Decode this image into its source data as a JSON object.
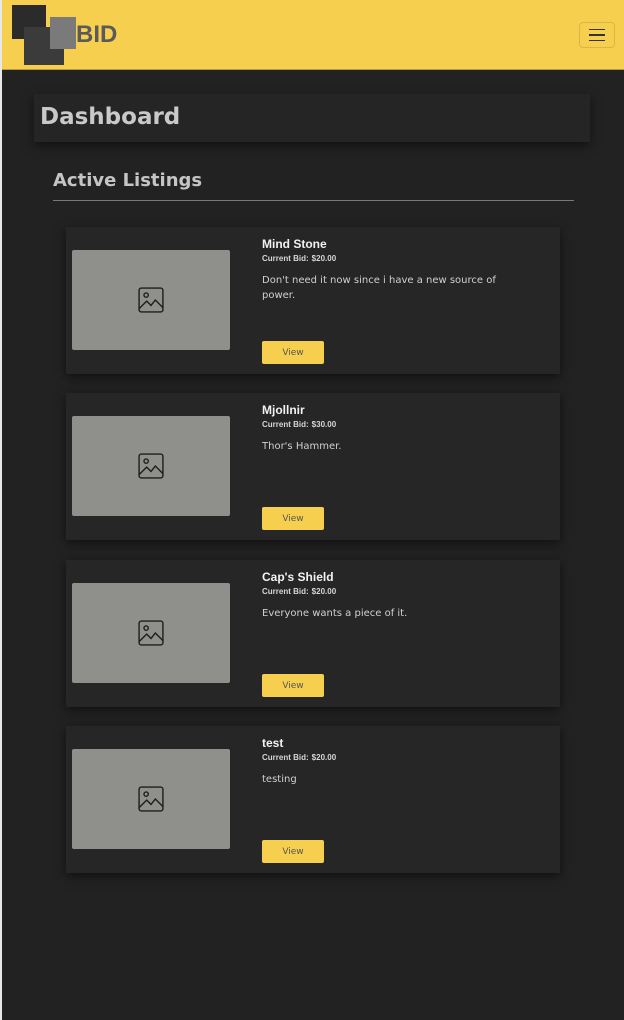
{
  "navbar": {
    "logo_text": "BID",
    "toggle_icon": "hamburger-menu-icon",
    "background": "#f7cf4f"
  },
  "page": {
    "title": "Dashboard"
  },
  "section": {
    "title": "Active Listings"
  },
  "listings": [
    {
      "title": "Mind Stone",
      "bid_label": "Current Bid:",
      "bid_value": "$20.00",
      "description": "Don't need it now since i have a new source of power.",
      "button_label": "View",
      "image_icon": "image-placeholder-icon"
    },
    {
      "title": "Mjollnir",
      "bid_label": "Current Bid:",
      "bid_value": "$30.00",
      "description": "Thor's Hammer.",
      "button_label": "View",
      "image_icon": "image-placeholder-icon"
    },
    {
      "title": "Cap's Shield",
      "bid_label": "Current Bid:",
      "bid_value": "$20.00",
      "description": "Everyone wants a piece of it.",
      "button_label": "View",
      "image_icon": "image-placeholder-icon"
    },
    {
      "title": "test",
      "bid_label": "Current Bid:",
      "bid_value": "$20.00",
      "description": "testing",
      "button_label": "View",
      "image_icon": "image-placeholder-icon"
    }
  ],
  "colors": {
    "accent": "#f7cf4f",
    "background": "#222222",
    "card": "#262626"
  }
}
